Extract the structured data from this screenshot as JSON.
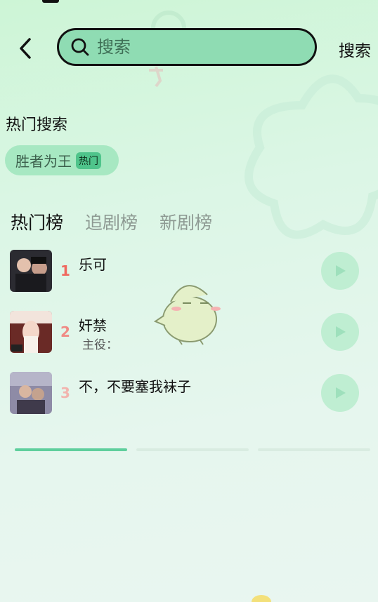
{
  "header": {
    "search_placeholder": "搜索",
    "search_button": "搜索"
  },
  "hot_search": {
    "title": "热门搜索",
    "chips": [
      {
        "label": "胜者为王",
        "badge": "热门"
      }
    ]
  },
  "tabs": [
    {
      "label": "热门榜",
      "active": true
    },
    {
      "label": "追剧榜",
      "active": false
    },
    {
      "label": "新剧榜",
      "active": false
    }
  ],
  "ranking": [
    {
      "rank": "1",
      "title": "乐可",
      "role": "",
      "rank_color": "#f0685e"
    },
    {
      "rank": "2",
      "title": "奸禁",
      "role": "主役：",
      "rank_color": "#f08a84"
    },
    {
      "rank": "3",
      "title": "不，不要塞我袜子",
      "role": "",
      "rank_color": "#f2b4ae"
    }
  ],
  "colors": {
    "accent": "#5fcf9d",
    "indicator_inactive": "#d9ece1"
  }
}
